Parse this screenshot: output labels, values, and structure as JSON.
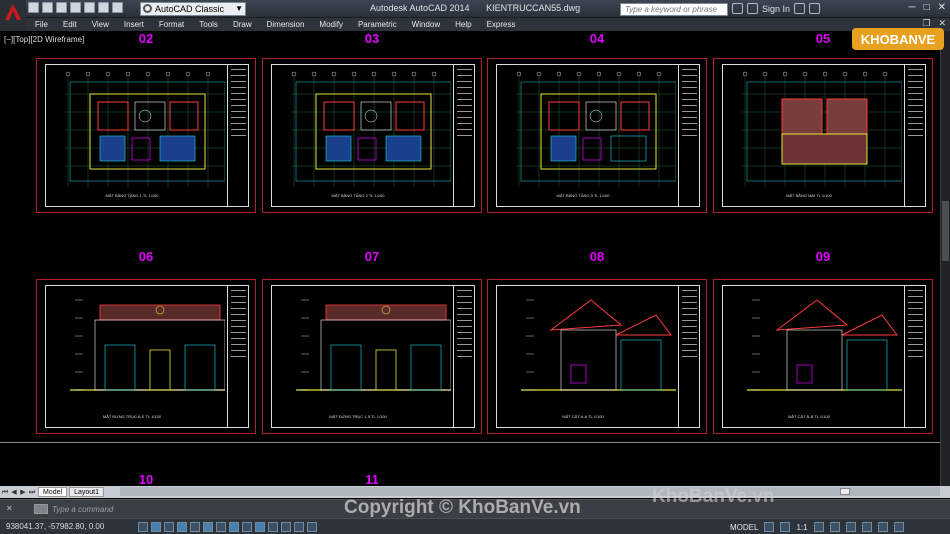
{
  "window": {
    "app_title": "Autodesk AutoCAD 2014",
    "file_name": "KIENTRUCCAN55.dwg",
    "workspace": "AutoCAD Classic",
    "search_placeholder": "Type a keyword or phrase",
    "signin_label": "Sign In"
  },
  "menu": [
    "File",
    "Edit",
    "View",
    "Insert",
    "Format",
    "Tools",
    "Draw",
    "Dimension",
    "Modify",
    "Parametric",
    "Window",
    "Help",
    "Express"
  ],
  "viewport_label": "[−][Top][2D Wireframe]",
  "sheets": [
    {
      "number": "02",
      "kind": "plan",
      "caption": "MẶT BẰNG TẦNG 1 TL 1/100"
    },
    {
      "number": "03",
      "kind": "plan",
      "caption": "MẶT BẰNG TẦNG 2 TL 1/100"
    },
    {
      "number": "04",
      "kind": "plan",
      "caption": "MẶT BẰNG TẦNG 3 TL 1/100"
    },
    {
      "number": "05",
      "kind": "plan",
      "caption": "MẶT BẰNG MÁI TL 1/100"
    },
    {
      "number": "06",
      "kind": "elevation",
      "caption": "MẶT ĐỨNG TRỤC A-E TL 1/100"
    },
    {
      "number": "07",
      "kind": "elevation",
      "caption": "MẶT ĐỨNG TRỤC 1-5 TL 1/100"
    },
    {
      "number": "08",
      "kind": "section",
      "caption": "MẶT CẮT A-A TL 1/100"
    },
    {
      "number": "09",
      "kind": "section",
      "caption": "MẶT CẮT B-B TL 1/100"
    }
  ],
  "next_sheet_numbers": [
    "10",
    "11"
  ],
  "tabs": [
    {
      "label": "Model",
      "active": true
    },
    {
      "label": "Layout1",
      "active": false
    }
  ],
  "command_placeholder": "Type a command",
  "status": {
    "coordinates": "938041.37, -57982.80, 0.00",
    "space": "MODEL",
    "annotation_scale": "1:1"
  },
  "watermarks": {
    "logo": "KHOBANVE",
    "copyright": "Copyright © KhoBanVe.vn",
    "site": "KhoBanVe.vn"
  },
  "colors": {
    "sheet_number": "#e100ff",
    "sheet_frame": "#b21c2c",
    "canvas": "#000000"
  }
}
